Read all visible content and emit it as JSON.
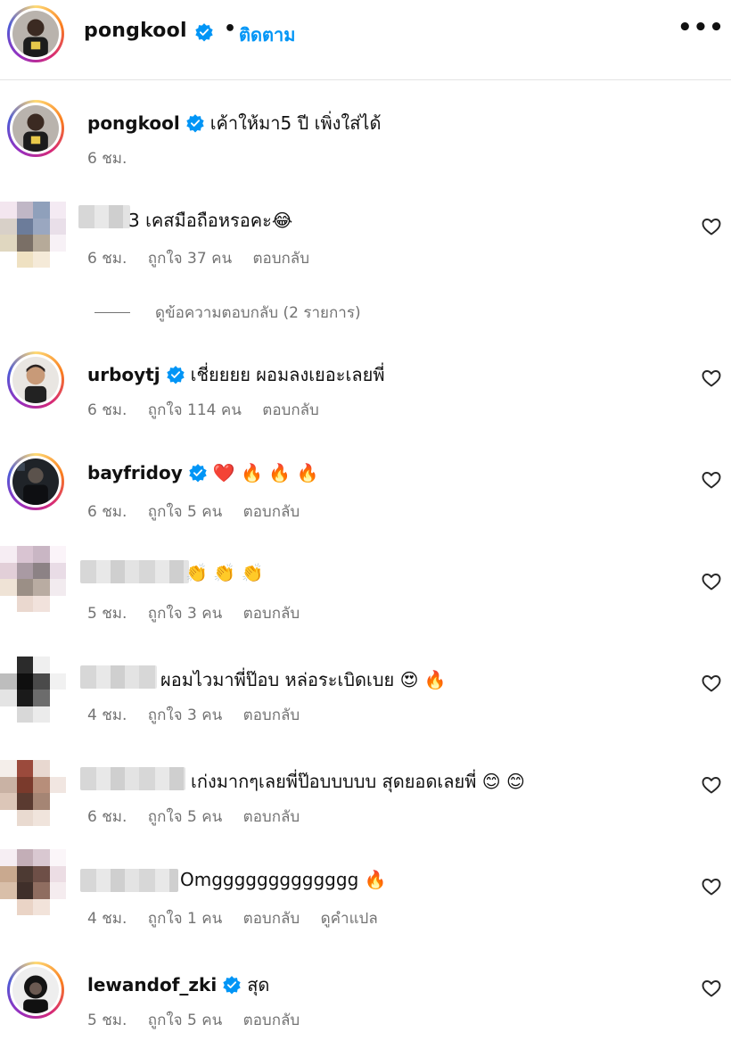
{
  "header": {
    "username": "pongkool",
    "separator": "•",
    "follow_label": "ติดตาม",
    "more_label": "•••"
  },
  "caption": {
    "username": "pongkool",
    "text": "เค้าให้มา5 ปี เพิ่งใส่ได้",
    "time": "6 ชม."
  },
  "comments": [
    {
      "username": "",
      "text": "3 เคสมือถือหรอคะ😂",
      "time": "6 ชม.",
      "likes": "ถูกใจ 37 คน",
      "reply": "ตอบกลับ",
      "verified": false,
      "blurred": true
    },
    {
      "username": "urboytj",
      "text": "เชี่ยยยย ผอมลงเยอะเลยพี่",
      "time": "6 ชม.",
      "likes": "ถูกใจ 114 คน",
      "reply": "ตอบกลับ",
      "verified": true,
      "blurred": false
    },
    {
      "username": "bayfridoy",
      "text": "❤️ 🔥 🔥 🔥",
      "time": "6 ชม.",
      "likes": "ถูกใจ 5 คน",
      "reply": "ตอบกลับ",
      "verified": true,
      "blurred": false
    },
    {
      "username": "",
      "text": "👏 👏 👏",
      "time": "5 ชม.",
      "likes": "ถูกใจ 3 คน",
      "reply": "ตอบกลับ",
      "verified": false,
      "blurred": true
    },
    {
      "username": "",
      "text": "ผอมไวมาพี่ป๊อบ หล่อระเบิดเบย 😍 🔥",
      "time": "4 ชม.",
      "likes": "ถูกใจ 3 คน",
      "reply": "ตอบกลับ",
      "verified": false,
      "blurred": true
    },
    {
      "username": "",
      "text": "เก่งมากๆเลยพี่ป๊อบบบบบ สุดยอดเลยพี่ 😊 😊",
      "time": "6 ชม.",
      "likes": "ถูกใจ 5 คน",
      "reply": "ตอบกลับ",
      "verified": false,
      "blurred": true
    },
    {
      "username": "",
      "text": "Omggggggggggggg 🔥",
      "time": "4 ชม.",
      "likes": "ถูกใจ 1 คน",
      "reply": "ตอบกลับ",
      "translate": "ดูคำแปล",
      "verified": false,
      "blurred": true
    },
    {
      "username": "lewandof_zki",
      "text": "สุด",
      "time": "5 ชม.",
      "likes": "ถูกใจ 5 คน",
      "reply": "ตอบกลับ",
      "verified": true,
      "blurred": false
    }
  ],
  "view_replies": "ดูข้อความตอบกลับ (2 รายการ)",
  "icons": {
    "verified": "verified-badge-icon",
    "like": "heart-icon",
    "more": "more-options-icon"
  },
  "colors": {
    "accent": "#0095f6",
    "meta": "#737373",
    "verified": "#0095f6"
  }
}
